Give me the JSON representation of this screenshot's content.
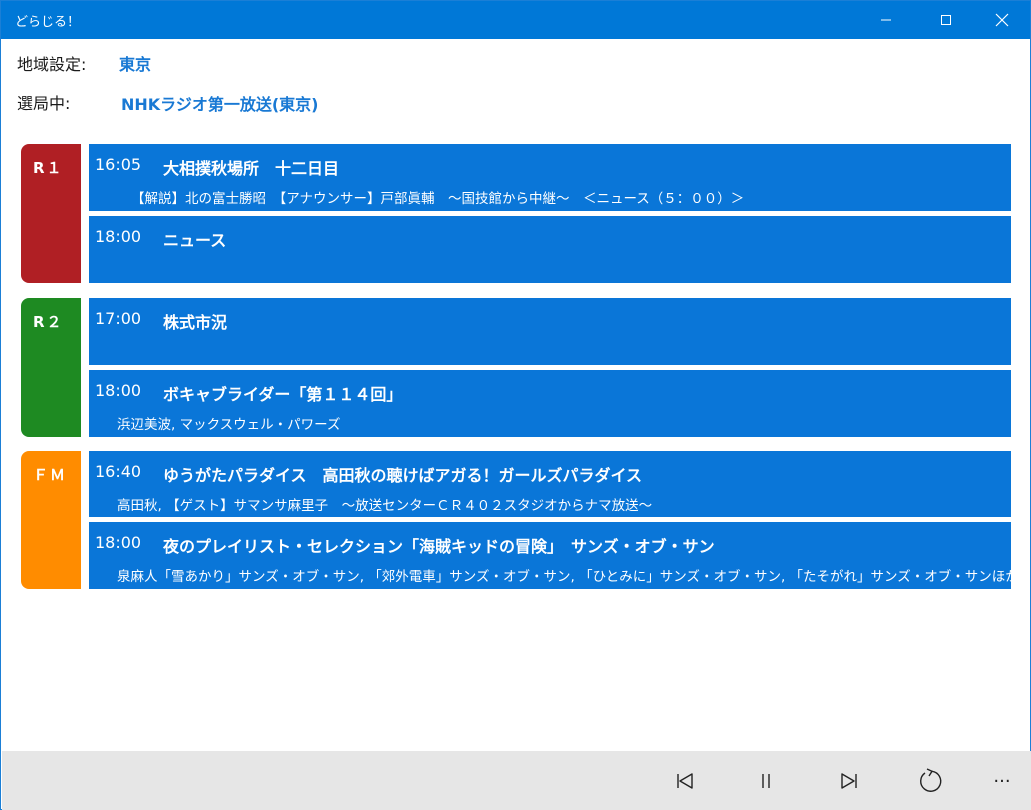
{
  "window": {
    "title": "どらじる！"
  },
  "settings": {
    "region_label": "地域設定:",
    "region_value": "東京",
    "station_label": "選局中:",
    "station_value": "NHKラジオ第一放送(東京)"
  },
  "stations": [
    {
      "code": "R１",
      "color": "#b01f24",
      "programs": [
        {
          "time": "16:05",
          "title": "大相撲秋場所　十二日目",
          "desc": "【解説】北の富士勝昭　【アナウンサー】戸部眞輔　～国技館から中継～　＜ニュース（５：００）＞"
        },
        {
          "time": "18:00",
          "title": "ニュース",
          "desc": ""
        }
      ]
    },
    {
      "code": "R２",
      "color": "#1e8a22",
      "programs": [
        {
          "time": "17:00",
          "title": "株式市況",
          "desc": ""
        },
        {
          "time": "18:00",
          "title": "ボキャブライダー「第１１４回」",
          "desc": "浜辺美波, マックスウェル・パワーズ"
        }
      ]
    },
    {
      "code": "ＦＭ",
      "color": "#ff8c00",
      "programs": [
        {
          "time": "16:40",
          "title": "ゆうがたパラダイス　高田秋の聴けばアガる！ガールズパラダイス",
          "desc": "高田秋, 【ゲスト】サマンサ麻里子　～放送センターＣＲ４０２スタジオからナマ放送～"
        },
        {
          "time": "18:00",
          "title": "夜のプレイリスト・セレクション「海賊キッドの冒険」　サンズ・オブ・サン",
          "desc": "泉麻人「雪あかり」サンズ・オブ・サン, 「郊外電車」サンズ・オブ・サン, 「ひとみに」サンズ・オブ・サン, 「たそがれ」サンズ・オブ・サンほか"
        }
      ]
    }
  ],
  "controls": {
    "more_label": "···",
    "icons": [
      "skip-previous-icon",
      "pause-icon",
      "skip-next-icon",
      "refresh-icon",
      "more-icon"
    ]
  }
}
